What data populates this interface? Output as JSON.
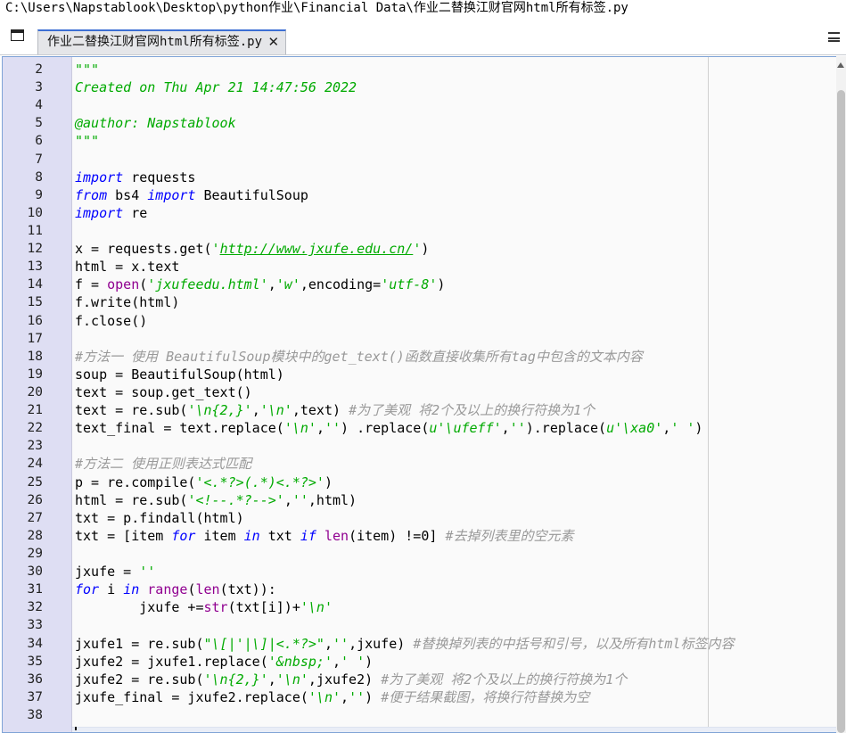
{
  "window": {
    "file_path": "C:\\Users\\Napstablook\\Desktop\\python作业\\Financial Data\\作业二替换江财官网html所有标签.py"
  },
  "toolbar": {
    "browse_tabs_icon": "browse-tabs-icon",
    "options_icon": "hamburger-menu-icon"
  },
  "tab": {
    "label": "作业二替换江财官网html所有标签.py",
    "close_label": "✕"
  },
  "editor": {
    "colors": {
      "keyword": "#0000ff",
      "string": "#00aa00",
      "comment": "#999999",
      "builtin": "#900090",
      "gutter": "#dedef3"
    },
    "lines": [
      {
        "n": "2",
        "tokens": [
          {
            "t": "\"\"\"",
            "c": "str"
          }
        ]
      },
      {
        "n": "3",
        "tokens": [
          {
            "t": "Created on Thu Apr 21 14:47:56 2022",
            "c": "str"
          }
        ]
      },
      {
        "n": "4",
        "tokens": []
      },
      {
        "n": "5",
        "tokens": [
          {
            "t": "@author: Napstablook",
            "c": "str"
          }
        ]
      },
      {
        "n": "6",
        "tokens": [
          {
            "t": "\"\"\"",
            "c": "str"
          }
        ]
      },
      {
        "n": "7",
        "tokens": []
      },
      {
        "n": "8",
        "tokens": [
          {
            "t": "import",
            "c": "kw"
          },
          {
            "t": " requests",
            "c": ""
          }
        ]
      },
      {
        "n": "9",
        "tokens": [
          {
            "t": "from",
            "c": "kw"
          },
          {
            "t": " bs4 ",
            "c": ""
          },
          {
            "t": "import",
            "c": "kw"
          },
          {
            "t": " BeautifulSoup",
            "c": ""
          }
        ]
      },
      {
        "n": "10",
        "tokens": [
          {
            "t": "import",
            "c": "kw"
          },
          {
            "t": " re",
            "c": ""
          }
        ]
      },
      {
        "n": "11",
        "tokens": []
      },
      {
        "n": "12",
        "tokens": [
          {
            "t": "x = requests.get(",
            "c": ""
          },
          {
            "t": "'",
            "c": "str"
          },
          {
            "t": "http://www.jxufe.edu.cn/",
            "c": "str url"
          },
          {
            "t": "'",
            "c": "str"
          },
          {
            "t": ")",
            "c": ""
          }
        ]
      },
      {
        "n": "13",
        "tokens": [
          {
            "t": "html = x.text",
            "c": ""
          }
        ]
      },
      {
        "n": "14",
        "tokens": [
          {
            "t": "f = ",
            "c": ""
          },
          {
            "t": "open",
            "c": "bi"
          },
          {
            "t": "(",
            "c": ""
          },
          {
            "t": "'jxufeedu.html'",
            "c": "str"
          },
          {
            "t": ",",
            "c": ""
          },
          {
            "t": "'w'",
            "c": "str"
          },
          {
            "t": ",encoding=",
            "c": ""
          },
          {
            "t": "'utf-8'",
            "c": "str"
          },
          {
            "t": ")",
            "c": ""
          }
        ]
      },
      {
        "n": "15",
        "tokens": [
          {
            "t": "f.write(html)",
            "c": ""
          }
        ]
      },
      {
        "n": "16",
        "tokens": [
          {
            "t": "f.close()",
            "c": ""
          }
        ]
      },
      {
        "n": "17",
        "tokens": []
      },
      {
        "n": "18",
        "tokens": [
          {
            "t": "#方法一 使用 BeautifulSoup模块中的get_text()函数直接收集所有tag中包含的文本内容",
            "c": "cmt"
          }
        ]
      },
      {
        "n": "19",
        "tokens": [
          {
            "t": "soup = BeautifulSoup(html)",
            "c": ""
          }
        ]
      },
      {
        "n": "20",
        "tokens": [
          {
            "t": "text = soup.get_text()",
            "c": ""
          }
        ]
      },
      {
        "n": "21",
        "tokens": [
          {
            "t": "text = re.sub(",
            "c": ""
          },
          {
            "t": "'\\n{2,}'",
            "c": "str"
          },
          {
            "t": ",",
            "c": ""
          },
          {
            "t": "'\\n'",
            "c": "str"
          },
          {
            "t": ",text) ",
            "c": ""
          },
          {
            "t": "#为了美观 将2个及以上的换行符换为1个",
            "c": "cmt"
          }
        ]
      },
      {
        "n": "22",
        "tokens": [
          {
            "t": "text_final = text.replace(",
            "c": ""
          },
          {
            "t": "'\\n'",
            "c": "str"
          },
          {
            "t": ",",
            "c": ""
          },
          {
            "t": "''",
            "c": "str"
          },
          {
            "t": ") .replace(",
            "c": ""
          },
          {
            "t": "u'\\ufeff'",
            "c": "str"
          },
          {
            "t": ",",
            "c": ""
          },
          {
            "t": "''",
            "c": "str"
          },
          {
            "t": ").replace(",
            "c": ""
          },
          {
            "t": "u'\\xa0'",
            "c": "str"
          },
          {
            "t": ",",
            "c": ""
          },
          {
            "t": "' '",
            "c": "str"
          },
          {
            "t": ")",
            "c": ""
          }
        ]
      },
      {
        "n": "23",
        "tokens": []
      },
      {
        "n": "24",
        "tokens": [
          {
            "t": "#方法二 使用正则表达式匹配",
            "c": "cmt"
          }
        ]
      },
      {
        "n": "25",
        "tokens": [
          {
            "t": "p = re.compile(",
            "c": ""
          },
          {
            "t": "'<.*?>(.*)<.*?>'",
            "c": "str"
          },
          {
            "t": ")",
            "c": ""
          }
        ]
      },
      {
        "n": "26",
        "tokens": [
          {
            "t": "html = re.sub(",
            "c": ""
          },
          {
            "t": "'<!--.*?-->'",
            "c": "str"
          },
          {
            "t": ",",
            "c": ""
          },
          {
            "t": "''",
            "c": "str"
          },
          {
            "t": ",html)",
            "c": ""
          }
        ]
      },
      {
        "n": "27",
        "tokens": [
          {
            "t": "txt = p.findall(html)",
            "c": ""
          }
        ]
      },
      {
        "n": "28",
        "tokens": [
          {
            "t": "txt = [item ",
            "c": ""
          },
          {
            "t": "for",
            "c": "kw"
          },
          {
            "t": " item ",
            "c": ""
          },
          {
            "t": "in",
            "c": "kw"
          },
          {
            "t": " txt ",
            "c": ""
          },
          {
            "t": "if",
            "c": "kw"
          },
          {
            "t": " ",
            "c": ""
          },
          {
            "t": "len",
            "c": "bi"
          },
          {
            "t": "(item) !=",
            "c": ""
          },
          {
            "t": "0",
            "c": "num"
          },
          {
            "t": "] ",
            "c": ""
          },
          {
            "t": "#去掉列表里的空元素",
            "c": "cmt"
          }
        ]
      },
      {
        "n": "29",
        "tokens": []
      },
      {
        "n": "30",
        "tokens": [
          {
            "t": "jxufe = ",
            "c": ""
          },
          {
            "t": "''",
            "c": "str"
          }
        ]
      },
      {
        "n": "31",
        "tokens": [
          {
            "t": "for",
            "c": "kw"
          },
          {
            "t": " i ",
            "c": ""
          },
          {
            "t": "in",
            "c": "kw"
          },
          {
            "t": " ",
            "c": ""
          },
          {
            "t": "range",
            "c": "bi"
          },
          {
            "t": "(",
            "c": ""
          },
          {
            "t": "len",
            "c": "bi"
          },
          {
            "t": "(txt)):",
            "c": ""
          }
        ]
      },
      {
        "n": "32",
        "tokens": [
          {
            "t": "        jxufe +=",
            "c": ""
          },
          {
            "t": "str",
            "c": "bi"
          },
          {
            "t": "(txt[i])+",
            "c": ""
          },
          {
            "t": "'\\n'",
            "c": "str"
          }
        ]
      },
      {
        "n": "33",
        "tokens": []
      },
      {
        "n": "34",
        "tokens": [
          {
            "t": "jxufe1 = re.sub(",
            "c": ""
          },
          {
            "t": "\"\\[|'|\\]|<.*?>\"",
            "c": "str"
          },
          {
            "t": ",",
            "c": ""
          },
          {
            "t": "''",
            "c": "str"
          },
          {
            "t": ",jxufe) ",
            "c": ""
          },
          {
            "t": "#替换掉列表的中括号和引号，以及所有html标签内容",
            "c": "cmt"
          }
        ]
      },
      {
        "n": "35",
        "tokens": [
          {
            "t": "jxufe2 = jxufe1.replace(",
            "c": ""
          },
          {
            "t": "'&nbsp;'",
            "c": "str"
          },
          {
            "t": ",",
            "c": ""
          },
          {
            "t": "' '",
            "c": "str"
          },
          {
            "t": ")",
            "c": ""
          }
        ]
      },
      {
        "n": "36",
        "tokens": [
          {
            "t": "jxufe2 = re.sub(",
            "c": ""
          },
          {
            "t": "'\\n{2,}'",
            "c": "str"
          },
          {
            "t": ",",
            "c": ""
          },
          {
            "t": "'\\n'",
            "c": "str"
          },
          {
            "t": ",jxufe2) ",
            "c": ""
          },
          {
            "t": "#为了美观 将2个及以上的换行符换为1个",
            "c": "cmt"
          }
        ]
      },
      {
        "n": "37",
        "tokens": [
          {
            "t": "jxufe_final = jxufe2.replace(",
            "c": ""
          },
          {
            "t": "'\\n'",
            "c": "str"
          },
          {
            "t": ",",
            "c": ""
          },
          {
            "t": "''",
            "c": "str"
          },
          {
            "t": ") ",
            "c": ""
          },
          {
            "t": "#便于结果截图，将换行符替换为空",
            "c": "cmt"
          }
        ]
      },
      {
        "n": "38",
        "tokens": []
      }
    ]
  }
}
